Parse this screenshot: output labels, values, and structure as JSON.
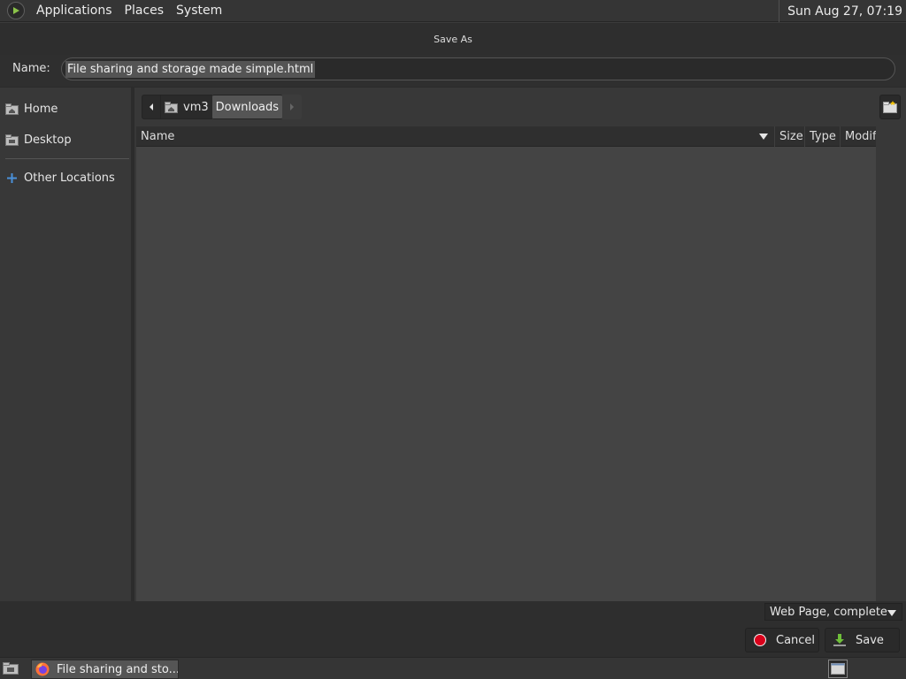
{
  "panel": {
    "menus": [
      "Applications",
      "Places",
      "System"
    ],
    "clock": "Sun Aug 27, 07:19"
  },
  "dialog": {
    "title": "Save As",
    "name_label": "Name:",
    "name_value": "File sharing and storage made simple.html"
  },
  "sidebar": {
    "items": [
      {
        "label": "Home",
        "icon": "home-folder-icon"
      },
      {
        "label": "Desktop",
        "icon": "desktop-folder-icon"
      },
      {
        "label": "Other Locations",
        "icon": "plus-icon"
      }
    ]
  },
  "path_bar": {
    "segments": [
      "vm3",
      "Downloads"
    ],
    "active": "Downloads"
  },
  "file_list": {
    "columns": [
      "Name",
      "Size",
      "Type",
      "Modif"
    ],
    "rows": []
  },
  "footer": {
    "filter": "Web Page, complete",
    "cancel_label": "Cancel",
    "save_label": "Save"
  },
  "taskbar": {
    "task_label": "File sharing and sto..."
  },
  "colors": {
    "panel": "#353535",
    "dialog_bg": "#383838",
    "list_bg": "#444444",
    "cancel_red": "#d9001b"
  }
}
